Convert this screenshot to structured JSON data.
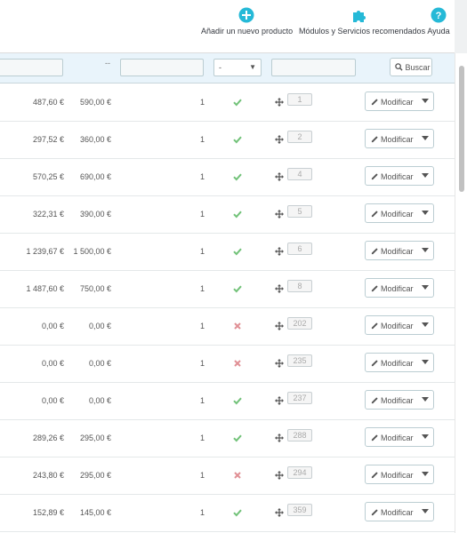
{
  "toolbar": {
    "add_product": "Añadir un nuevo producto",
    "modules": "Módulos y Servicios recomendados",
    "help": "Ayuda"
  },
  "filters": {
    "dots": "--",
    "select_value": "-",
    "search_label": "Buscar"
  },
  "colors": {
    "accent": "#25b9d7",
    "ok": "#72c279",
    "error": "#e08f95"
  },
  "rows": [
    {
      "price_excl": "487,60 €",
      "price_incl": "590,00 €",
      "qty": "1",
      "status": "ok",
      "position": "1",
      "action": "Modificar"
    },
    {
      "price_excl": "297,52 €",
      "price_incl": "360,00 €",
      "qty": "1",
      "status": "ok",
      "position": "2",
      "action": "Modificar"
    },
    {
      "price_excl": "570,25 €",
      "price_incl": "690,00 €",
      "qty": "1",
      "status": "ok",
      "position": "4",
      "action": "Modificar"
    },
    {
      "price_excl": "322,31 €",
      "price_incl": "390,00 €",
      "qty": "1",
      "status": "ok",
      "position": "5",
      "action": "Modificar"
    },
    {
      "price_excl": "1 239,67 €",
      "price_incl": "1 500,00 €",
      "qty": "1",
      "status": "ok",
      "position": "6",
      "action": "Modificar"
    },
    {
      "price_excl": "1 487,60 €",
      "price_incl": "750,00 €",
      "qty": "1",
      "status": "ok",
      "position": "8",
      "action": "Modificar"
    },
    {
      "price_excl": "0,00 €",
      "price_incl": "0,00 €",
      "qty": "1",
      "status": "off",
      "position": "202",
      "action": "Modificar"
    },
    {
      "price_excl": "0,00 €",
      "price_incl": "0,00 €",
      "qty": "1",
      "status": "off",
      "position": "235",
      "action": "Modificar"
    },
    {
      "price_excl": "0,00 €",
      "price_incl": "0,00 €",
      "qty": "1",
      "status": "ok",
      "position": "237",
      "action": "Modificar"
    },
    {
      "price_excl": "289,26 €",
      "price_incl": "295,00 €",
      "qty": "1",
      "status": "ok",
      "position": "288",
      "action": "Modificar"
    },
    {
      "price_excl": "243,80 €",
      "price_incl": "295,00 €",
      "qty": "1",
      "status": "off",
      "position": "294",
      "action": "Modificar"
    },
    {
      "price_excl": "152,89 €",
      "price_incl": "145,00 €",
      "qty": "1",
      "status": "ok",
      "position": "359",
      "action": "Modificar"
    }
  ]
}
